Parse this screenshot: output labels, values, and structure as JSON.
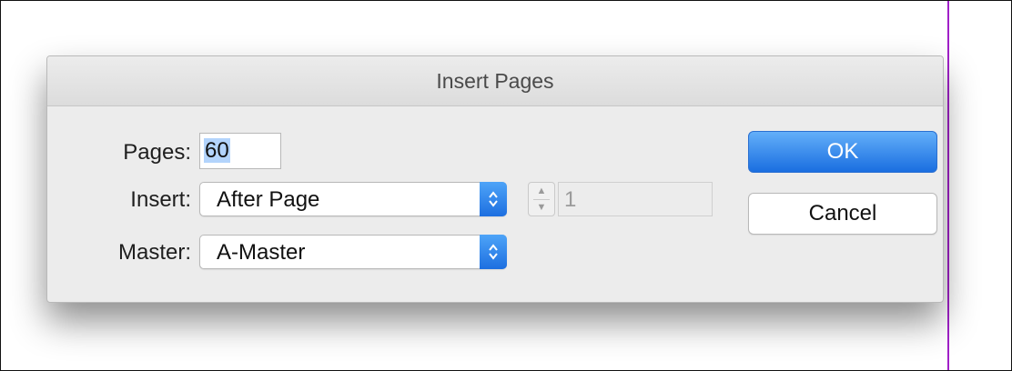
{
  "dialog": {
    "title": "Insert Pages",
    "pages": {
      "label": "Pages:",
      "value": "60"
    },
    "insert": {
      "label": "Insert:",
      "selected": "After Page",
      "page_number": "1"
    },
    "master": {
      "label": "Master:",
      "selected": "A-Master"
    },
    "buttons": {
      "ok": "OK",
      "cancel": "Cancel"
    }
  },
  "icons": {
    "select_arrows": "up-down-chevron-icon",
    "stepper": "stepper-icon"
  },
  "colors": {
    "accent": "#1d6fe0",
    "guide_line": "#a020c8",
    "dialog_bg": "#ececec"
  }
}
